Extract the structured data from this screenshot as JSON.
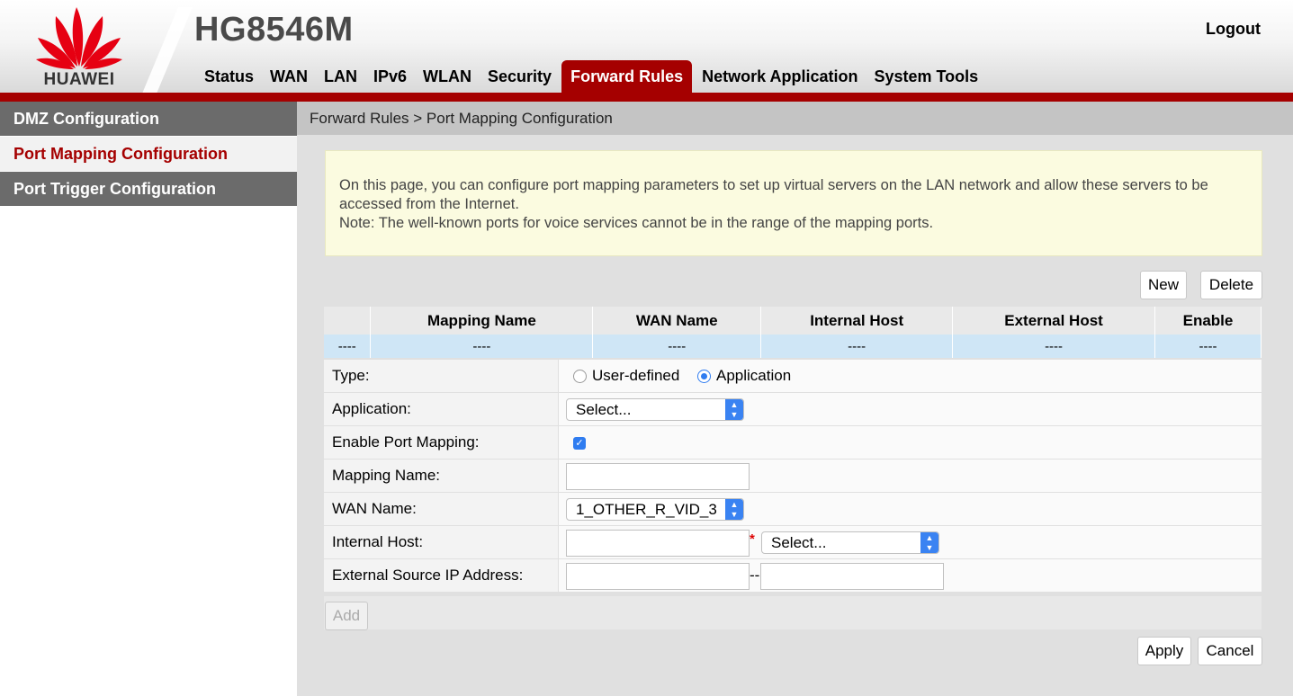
{
  "header": {
    "brand": "HUAWEI",
    "model": "HG8546M",
    "logout": "Logout",
    "nav": [
      "Status",
      "WAN",
      "LAN",
      "IPv6",
      "WLAN",
      "Security",
      "Forward Rules",
      "Network Application",
      "System Tools"
    ],
    "active_nav": "Forward Rules"
  },
  "sidebar": {
    "items": [
      "DMZ Configuration",
      "Port Mapping Configuration",
      "Port Trigger Configuration"
    ],
    "active": "Port Mapping Configuration"
  },
  "breadcrumb": "Forward Rules > Port Mapping Configuration",
  "notice": {
    "line1": "On this page, you can configure port mapping parameters to set up virtual servers on the LAN network and allow these servers to be accessed from the Internet.",
    "line2": "Note: The well-known ports for voice services cannot be in the range of the mapping ports."
  },
  "buttons": {
    "new": "New",
    "delete": "Delete",
    "add": "Add",
    "apply": "Apply",
    "cancel": "Cancel"
  },
  "table": {
    "headers": [
      "",
      "Mapping Name",
      "WAN Name",
      "Internal Host",
      "External Host",
      "Enable"
    ],
    "rows": [
      [
        "----",
        "----",
        "----",
        "----",
        "----",
        "----"
      ]
    ]
  },
  "form": {
    "type_label": "Type:",
    "type_options": [
      "User-defined",
      "Application"
    ],
    "type_selected": "Application",
    "application_label": "Application:",
    "application_value": "Select...",
    "enable_label": "Enable Port Mapping:",
    "enable_checked": true,
    "mapping_name_label": "Mapping Name:",
    "mapping_name_value": "",
    "wan_name_label": "WAN Name:",
    "wan_name_value": "1_OTHER_R_VID_3",
    "internal_host_label": "Internal Host:",
    "internal_host_value": "",
    "internal_host_select": "Select...",
    "required_mark": "*",
    "external_ip_label": "External Source IP Address:",
    "external_ip_start": "",
    "external_ip_separator": "--",
    "external_ip_end": ""
  },
  "colors": {
    "brand_red": "#a50000",
    "row_blue": "#cfe6f6",
    "notice_bg": "#fbfbe0"
  }
}
